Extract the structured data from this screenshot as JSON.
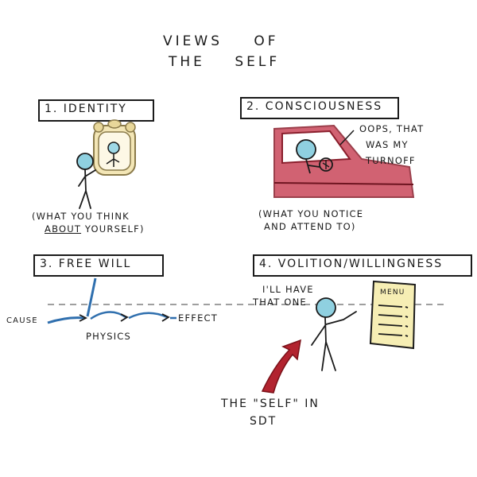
{
  "title": {
    "line1": "VIEWS OF",
    "line2": "THE SELF"
  },
  "panels": [
    {
      "heading": "1. IDENTITY",
      "caption_line1": "(WHAT YOU THINK",
      "caption_line2_pre": "",
      "caption_line2_underlined": "ABOUT",
      "caption_line2_post": " YOURSELF)"
    },
    {
      "heading": "2. CONSCIOUSNESS",
      "speech_line1": "OOPS, THAT",
      "speech_line2": "WAS MY",
      "speech_line3": "TURNOFF",
      "caption_line1": "(WHAT YOU NOTICE",
      "caption_line2": "AND ATTEND TO)"
    },
    {
      "heading": "3. FREE WILL",
      "cause_label": "CAUSE",
      "effect_label": "EFFECT",
      "physics_label": "PHYSICS"
    },
    {
      "heading": "4. VOLITION/WILLINGNESS",
      "speech_line1": "I'LL HAVE",
      "speech_line2": "THAT ONE",
      "menu_label": "MENU"
    }
  ],
  "footer": {
    "line1": "THE \"SELF\" IN",
    "line2": "SDT"
  },
  "colors": {
    "ink": "#1a1a1a",
    "car_red": "#b8313f",
    "head_blue": "#8fd0e0",
    "arrow_blue": "#2f6fae",
    "mirror_gold": "#e8d79a",
    "menu_yellow": "#f6eeb4",
    "pointer_red": "#b2232f"
  }
}
